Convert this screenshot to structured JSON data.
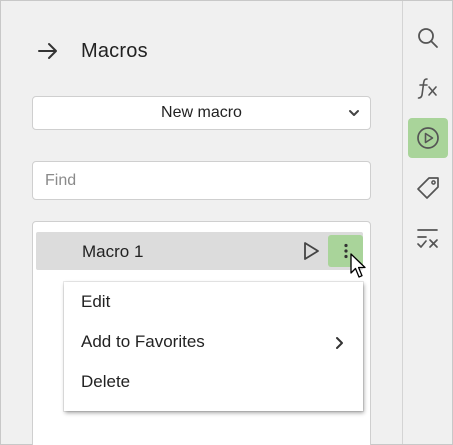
{
  "panel": {
    "title": "Macros",
    "back_icon": "arrow-right-icon",
    "new_macro": {
      "label": "New macro",
      "icon": "chevron-down-icon"
    },
    "find": {
      "placeholder": "Find",
      "value": ""
    }
  },
  "macros": [
    {
      "name": "Macro 1",
      "selected": true,
      "run_icon": "play-icon",
      "more_icon": "kebab-menu-icon"
    }
  ],
  "context_menu": {
    "items": [
      {
        "label": "Edit",
        "has_submenu": false
      },
      {
        "label": "Add to Favorites",
        "has_submenu": true
      },
      {
        "label": "Delete",
        "has_submenu": false
      }
    ]
  },
  "rail": {
    "items": [
      {
        "icon": "search-icon",
        "active": false
      },
      {
        "icon": "function-icon",
        "active": false
      },
      {
        "icon": "play-circle-icon",
        "active": true
      },
      {
        "icon": "tag-icon",
        "active": false
      },
      {
        "icon": "checklist-icon",
        "active": false
      }
    ]
  },
  "colors": {
    "accent": "#a9d49a",
    "selected_row": "#dcdcdc",
    "panel_bg": "#f0f0f0"
  }
}
